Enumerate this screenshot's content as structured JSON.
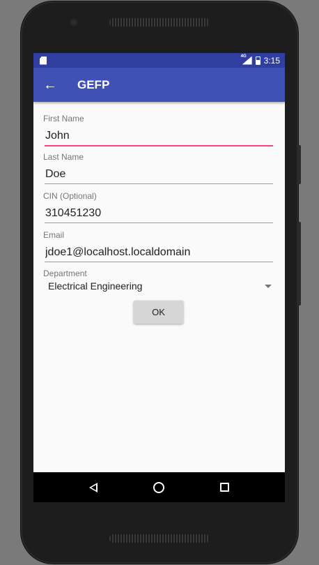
{
  "statusbar": {
    "time": "3:15",
    "network_label": "4G"
  },
  "toolbar": {
    "title": "GEFP",
    "back_icon": "arrow-back-icon"
  },
  "form": {
    "first_name": {
      "label": "First Name",
      "value": "John"
    },
    "last_name": {
      "label": "Last Name",
      "value": "Doe"
    },
    "cin": {
      "label": "CIN (Optional)",
      "value": "310451230"
    },
    "email": {
      "label": "Email",
      "value": "jdoe1@localhost.localdomain"
    },
    "department": {
      "label": "Department",
      "selected": "Electrical Engineering"
    },
    "ok_label": "OK"
  },
  "navbar": {
    "icons": [
      "back-triangle-icon",
      "home-circle-icon",
      "recents-square-icon"
    ]
  },
  "colors": {
    "toolbar": "#3f51b5",
    "statusbar": "#303f9f",
    "accent": "#ff4081"
  }
}
